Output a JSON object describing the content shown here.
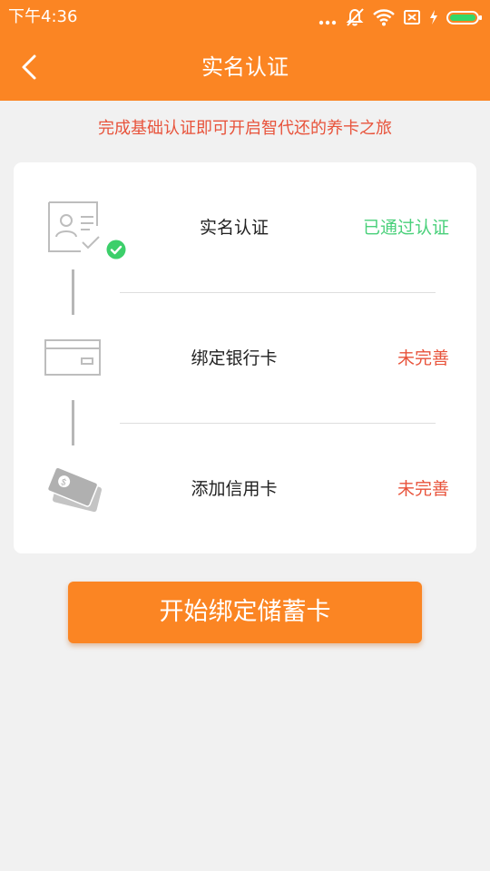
{
  "status_bar": {
    "time": "下午4:36",
    "icons": [
      "more-dots-icon",
      "mute-icon",
      "wifi-icon",
      "sim-error-icon",
      "charging-icon",
      "battery-icon"
    ]
  },
  "nav": {
    "back_icon": "back-arrow-icon",
    "title": "实名认证"
  },
  "notice": "完成基础认证即可开启智代还的养卡之旅",
  "steps": [
    {
      "label": "实名认证",
      "status": "已通过认证",
      "icon": "id-card-icon",
      "completed": true
    },
    {
      "label": "绑定银行卡",
      "status": "未完善",
      "icon": "bank-card-icon",
      "completed": false
    },
    {
      "label": "添加信用卡",
      "status": "未完善",
      "icon": "credit-cards-icon",
      "completed": false
    }
  ],
  "primary_button": {
    "label": "开始绑定储蓄卡"
  },
  "colors": {
    "brand_orange": "#fb8523",
    "success_green": "#49d07a",
    "warning_red": "#e8533b",
    "background": "#f1f1f1"
  }
}
